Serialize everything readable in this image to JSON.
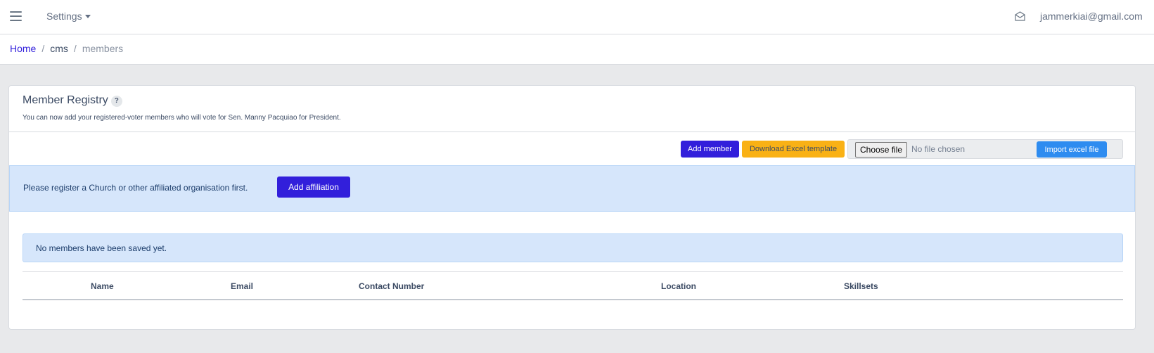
{
  "header": {
    "settings_label": "Settings",
    "user_email": "jammerkiai@gmail.com"
  },
  "breadcrumb": {
    "home": "Home",
    "cms": "cms",
    "current": "members"
  },
  "card": {
    "title": "Member Registry",
    "help": "?",
    "subtitle": "You can now add your registered-voter members who will vote for Sen. Manny Pacquiao for President."
  },
  "toolbar": {
    "add_member": "Add member",
    "download_template": "Download Excel template",
    "choose_file": "Choose file",
    "no_file": "No file chosen",
    "import": "Import excel file"
  },
  "affiliation": {
    "message": "Please register a Church or other affiliated organisation first.",
    "button": "Add affiliation"
  },
  "empty_message": "No members have been saved yet.",
  "table": {
    "columns": [
      "Name",
      "Email",
      "Contact Number",
      "Location",
      "Skillsets"
    ]
  },
  "colors": {
    "primary": "#321fdb",
    "warning": "#f9b115",
    "info": "#2e8cf0",
    "alert_bg": "#d6e6fb"
  },
  "icons": {
    "menu": "hamburger-icon",
    "mail": "envelope-open-icon"
  }
}
